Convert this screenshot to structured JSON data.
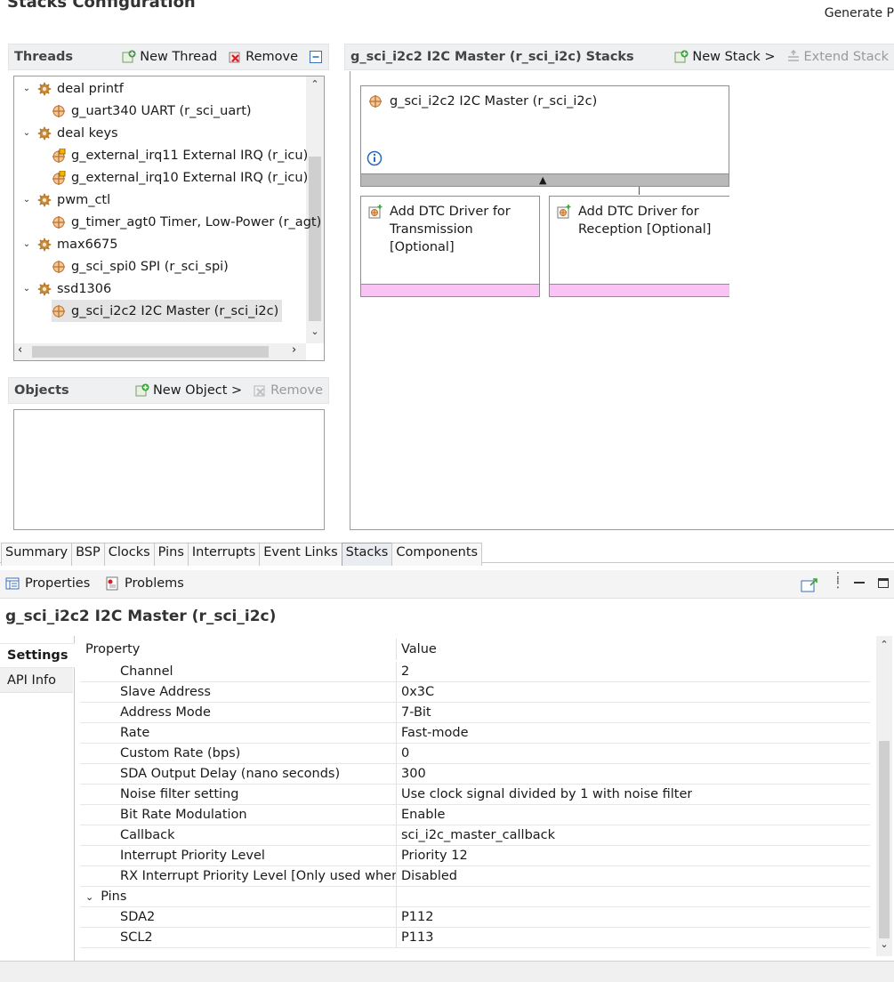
{
  "page": {
    "title": "Stacks Configuration",
    "generate_label": "Generate P"
  },
  "threads": {
    "title": "Threads",
    "new_label": "New Thread",
    "remove_label": "Remove",
    "items": [
      {
        "label": "deal printf",
        "type": "thread"
      },
      {
        "label": "g_uart340 UART (r_sci_uart)",
        "type": "module"
      },
      {
        "label": "deal keys",
        "type": "thread"
      },
      {
        "label": "g_external_irq11 External IRQ (r_icu)",
        "type": "module-warn"
      },
      {
        "label": "g_external_irq10 External IRQ (r_icu)",
        "type": "module-warn"
      },
      {
        "label": "pwm_ctl",
        "type": "thread"
      },
      {
        "label": "g_timer_agt0 Timer, Low-Power (r_agt)",
        "type": "module"
      },
      {
        "label": "max6675",
        "type": "thread"
      },
      {
        "label": "g_sci_spi0 SPI (r_sci_spi)",
        "type": "module"
      },
      {
        "label": "ssd1306",
        "type": "thread"
      },
      {
        "label": "g_sci_i2c2 I2C Master (r_sci_i2c)",
        "type": "module"
      }
    ]
  },
  "objects": {
    "title": "Objects",
    "new_label": "New Object >",
    "remove_label": "Remove"
  },
  "stacks": {
    "title": "g_sci_i2c2 I2C Master (r_sci_i2c) Stacks",
    "new_label": "New Stack >",
    "extend_label": "Extend Stack",
    "main_module": "g_sci_i2c2 I2C Master (r_sci_i2c)",
    "children": [
      {
        "lines": [
          "Add DTC Driver for",
          "Transmission",
          "[Optional]"
        ]
      },
      {
        "lines": [
          "Add DTC Driver for",
          "Reception [Optional]"
        ]
      }
    ]
  },
  "editor_tabs": [
    "Summary",
    "BSP",
    "Clocks",
    "Pins",
    "Interrupts",
    "Event Links",
    "Stacks",
    "Components"
  ],
  "active_editor_tab": "Stacks",
  "views": {
    "properties_label": "Properties",
    "problems_label": "Problems"
  },
  "properties": {
    "title": "g_sci_i2c2 I2C Master (r_sci_i2c)",
    "side_tabs": [
      "Settings",
      "API Info"
    ],
    "col_property": "Property",
    "col_value": "Value",
    "rows": [
      {
        "name": "Channel",
        "value": "2"
      },
      {
        "name": "Slave Address",
        "value": "0x3C"
      },
      {
        "name": "Address Mode",
        "value": "7-Bit"
      },
      {
        "name": "Rate",
        "value": "Fast-mode"
      },
      {
        "name": "Custom Rate (bps)",
        "value": "0"
      },
      {
        "name": "SDA Output Delay (nano seconds)",
        "value": "300"
      },
      {
        "name": "Noise filter setting",
        "value": "Use clock signal divided by 1 with noise filter"
      },
      {
        "name": "Bit Rate Modulation",
        "value": "Enable"
      },
      {
        "name": "Callback",
        "value": "sci_i2c_master_callback"
      },
      {
        "name": "Interrupt Priority Level",
        "value": "Priority 12"
      },
      {
        "name": "RX Interrupt Priority Level [Only used when DTC is enabled]",
        "value": "Disabled"
      },
      {
        "name": "Pins",
        "value": "",
        "group": true
      },
      {
        "name": "SDA2",
        "value": "P112"
      },
      {
        "name": "SCL2",
        "value": "P113"
      }
    ]
  },
  "colors": {
    "accent_pink": "#f9c4f4",
    "bar_gray": "#b9b9b9",
    "info_blue": "#2a66c4",
    "gear": "#c88b3a"
  }
}
